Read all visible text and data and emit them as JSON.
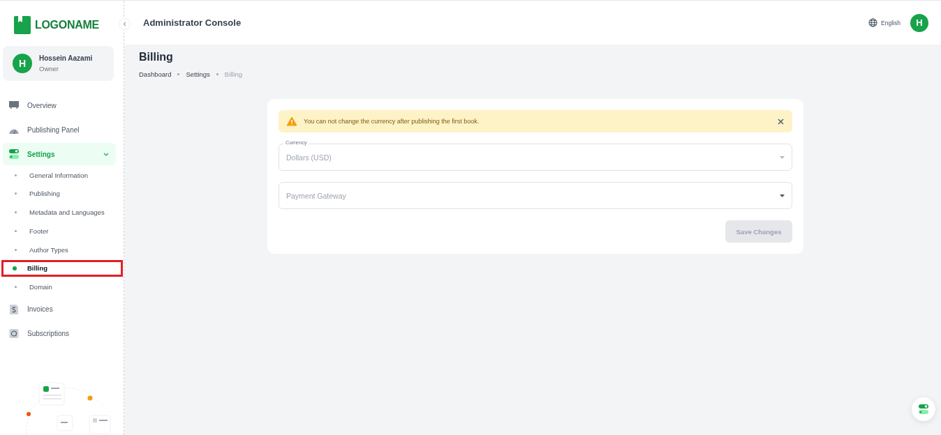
{
  "logo": {
    "text": "LOGONAME"
  },
  "user": {
    "initial": "H",
    "name": "Hossein Aazami",
    "role": "Owner"
  },
  "nav": [
    {
      "label": "Overview",
      "selected": false
    },
    {
      "label": "Publishing Panel",
      "selected": false
    },
    {
      "label": "Settings",
      "selected": true,
      "expanded": true,
      "children": [
        {
          "label": "General Information",
          "selected": false
        },
        {
          "label": "Publishing",
          "selected": false
        },
        {
          "label": "Metadata and Languages",
          "selected": false
        },
        {
          "label": "Footer",
          "selected": false
        },
        {
          "label": "Author Types",
          "selected": false
        },
        {
          "label": "Billing",
          "selected": true
        },
        {
          "label": "Domain",
          "selected": false
        }
      ]
    },
    {
      "label": "Invoices",
      "selected": false
    },
    {
      "label": "Subscriptions",
      "selected": false
    }
  ],
  "header": {
    "title": "Administrator Console",
    "language": "English",
    "avatar_initial": "H"
  },
  "page": {
    "title": "Billing",
    "breadcrumbs": [
      {
        "label": "Dashboard",
        "selected": false
      },
      {
        "label": "Settings",
        "selected": false
      },
      {
        "label": "Billing",
        "selected": true
      }
    ]
  },
  "alert": {
    "text": "You can not change the currency after publishing the first book."
  },
  "fields": [
    {
      "label": "Currency",
      "value": "Dollars (USD)"
    },
    {
      "placeholder": "Payment Gateway"
    }
  ],
  "save_button": {
    "label": "Save Changes",
    "disabled": true
  }
}
